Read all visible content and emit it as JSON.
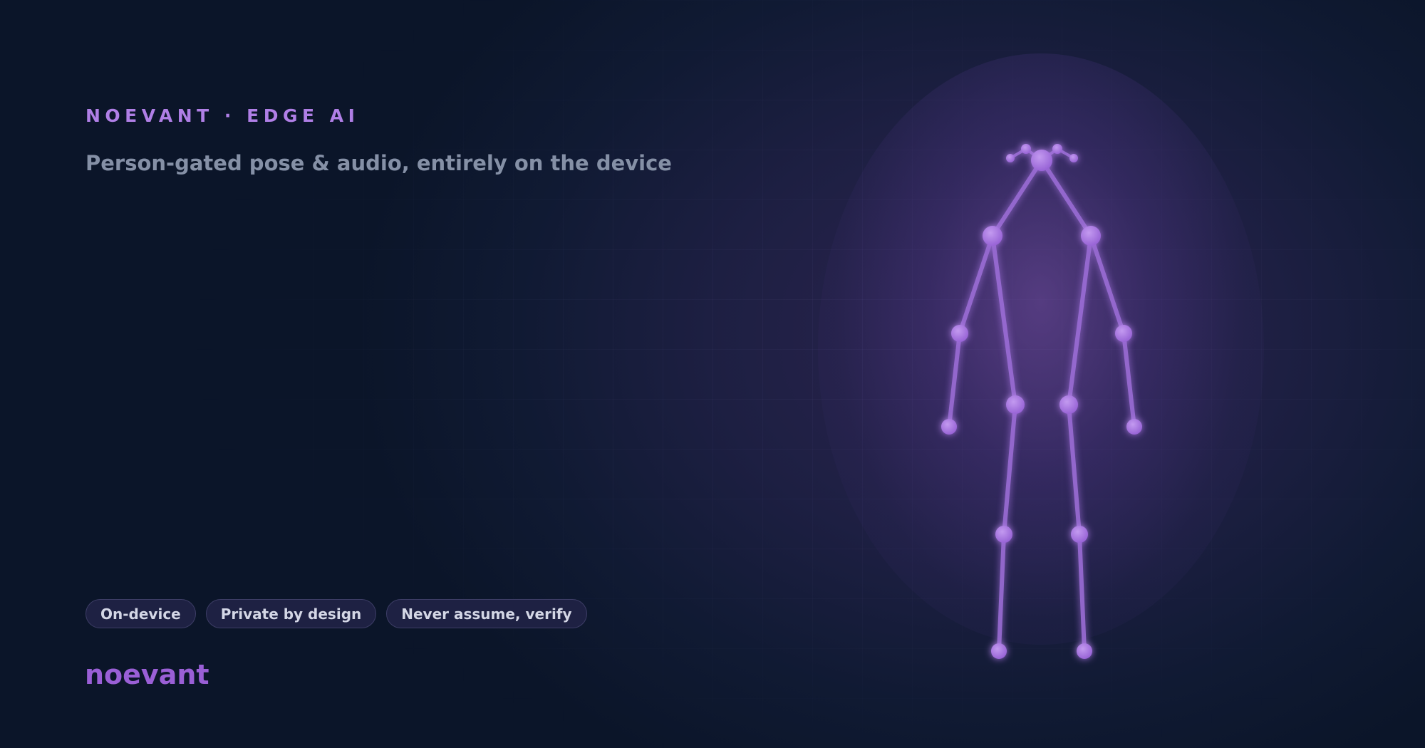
{
  "header": {
    "eyebrow": "NOEVANT · EDGE AI",
    "subtitle": "Person-gated pose & audio, entirely on the device"
  },
  "pills": [
    {
      "label": "On-device"
    },
    {
      "label": "Private by design"
    },
    {
      "label": "Never assume, verify"
    }
  ],
  "brand": {
    "wordmark": "noevant"
  },
  "figure": {
    "icon": "pose-skeleton-icon",
    "joints": [
      {
        "name": "head"
      },
      {
        "name": "left-ear"
      },
      {
        "name": "left-ear-tip"
      },
      {
        "name": "right-ear"
      },
      {
        "name": "right-ear-tip"
      },
      {
        "name": "left-shoulder"
      },
      {
        "name": "right-shoulder"
      },
      {
        "name": "left-elbow"
      },
      {
        "name": "right-elbow"
      },
      {
        "name": "left-wrist"
      },
      {
        "name": "right-wrist"
      },
      {
        "name": "left-hip"
      },
      {
        "name": "right-hip"
      },
      {
        "name": "left-knee"
      },
      {
        "name": "right-knee"
      },
      {
        "name": "left-ankle"
      },
      {
        "name": "right-ankle"
      }
    ]
  },
  "colors": {
    "background": "#0b1529",
    "accent": "#b07fe6",
    "joint": "#a878e0",
    "bone": "#9d6ed8",
    "subtitle": "#8590a6",
    "wordmark": "#9a5fd6"
  }
}
